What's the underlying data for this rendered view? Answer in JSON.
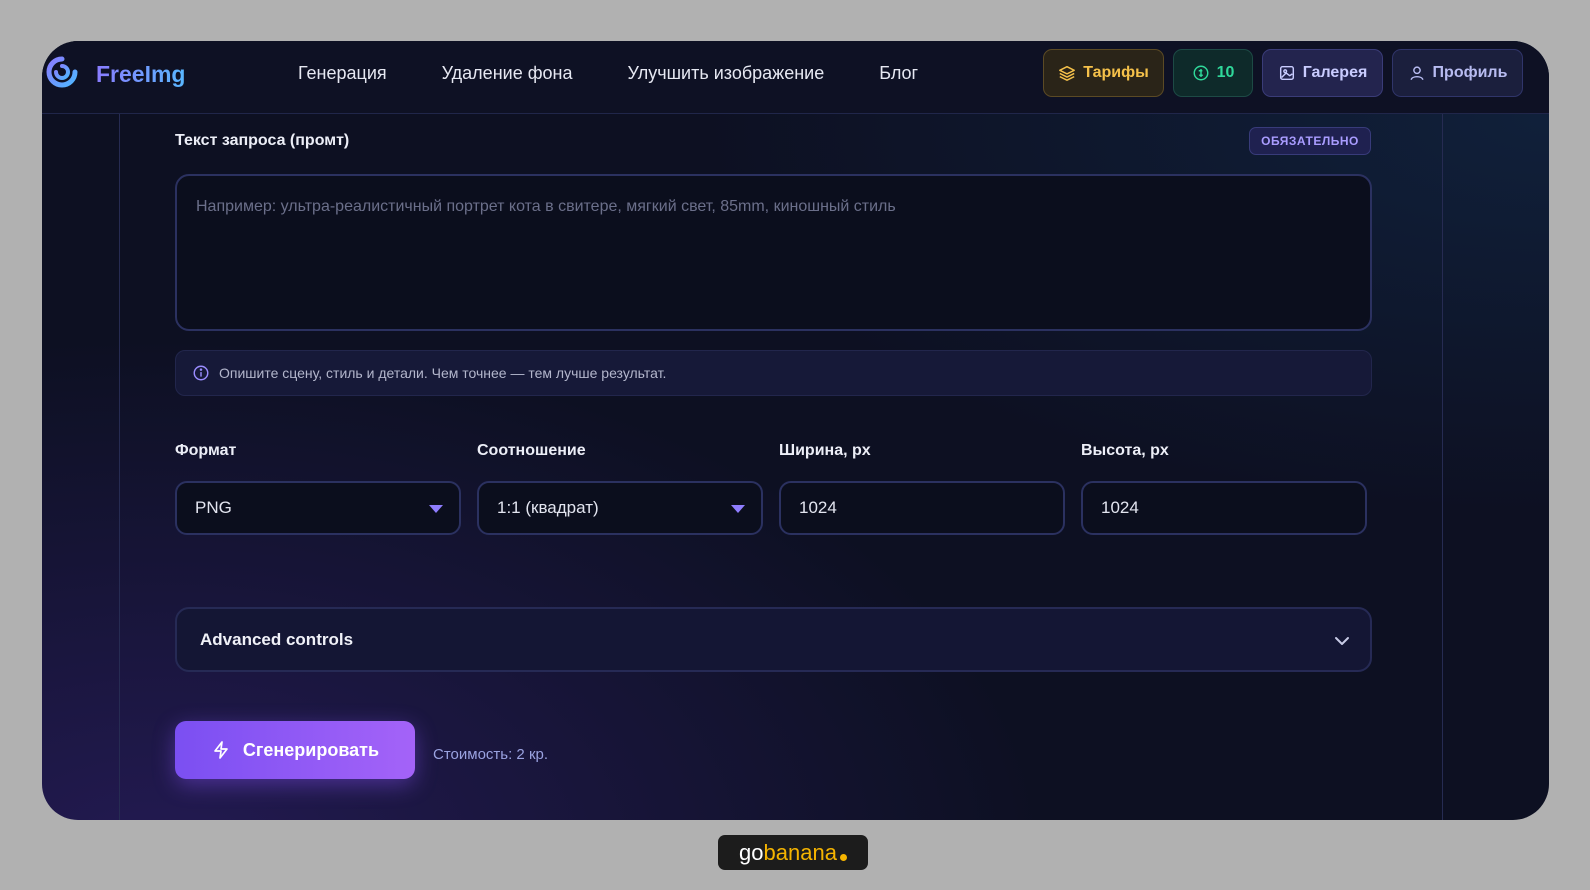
{
  "header": {
    "brand": "FreeImg",
    "nav": [
      "Генерация",
      "Удаление фона",
      "Улучшить изображение",
      "Блог"
    ],
    "tariffs_label": "Тарифы",
    "credits_value": "10",
    "gallery_label": "Галерея",
    "profile_label": "Профиль"
  },
  "form": {
    "prompt_label": "Текст запроса (промт)",
    "required_badge": "ОБЯЗАТЕЛЬНО",
    "prompt_value": "",
    "prompt_placeholder": "Например: ультра-реалистичный портрет кота в свитере, мягкий свет, 85mm, киношный стиль",
    "hint": "Опишите сцену, стиль и детали. Чем точнее — тем лучше результат.",
    "format_label": "Формат",
    "format_value": "PNG",
    "ratio_label": "Соотношение",
    "ratio_value": "1:1 (квадрат)",
    "width_label": "Ширина, px",
    "width_value": "1024",
    "height_label": "Высота, px",
    "height_value": "1024",
    "advanced_label": "Advanced controls",
    "generate_label": "Сгенерировать",
    "cost": "Стоимость: 2 кр."
  },
  "watermark": {
    "part1": "go",
    "part2": "banana"
  },
  "colors": {
    "accent": "#8b5cf6",
    "background": "#0d1022",
    "tariffs": "#f5c14a",
    "credits": "#2fd89a"
  },
  "icons": [
    "logo-icon",
    "layers-icon",
    "coin-icon",
    "image-icon",
    "user-icon",
    "info-icon",
    "chevron-down-icon",
    "lightning-icon"
  ]
}
